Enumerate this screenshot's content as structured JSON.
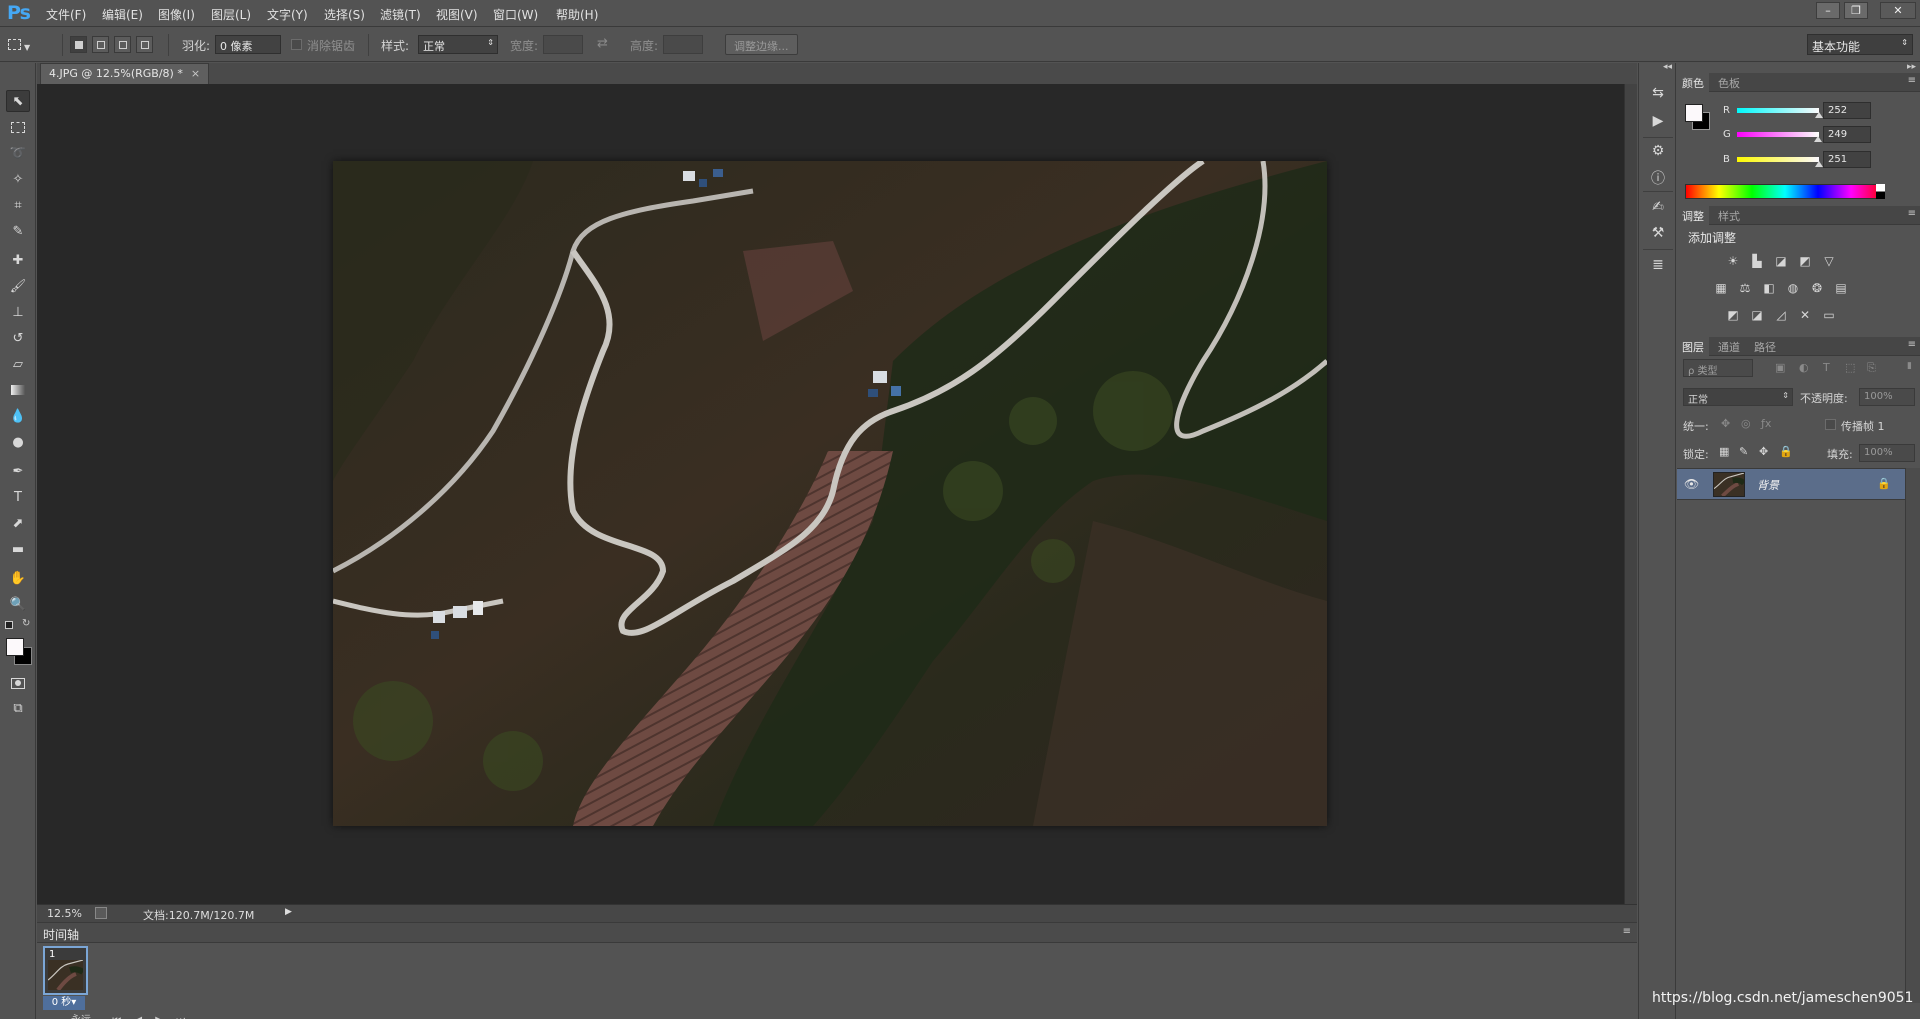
{
  "app": {
    "logo": "Ps"
  },
  "menu": [
    "文件(F)",
    "编辑(E)",
    "图像(I)",
    "图层(L)",
    "文字(Y)",
    "选择(S)",
    "滤镜(T)",
    "视图(V)",
    "窗口(W)",
    "帮助(H)"
  ],
  "window_controls": {
    "minimize": "–",
    "restore": "❐",
    "close": "✕"
  },
  "options": {
    "feather_label": "羽化:",
    "feather_value": "0 像素",
    "antialias_label": "消除锯齿",
    "style_label": "样式:",
    "style_value": "正常",
    "width_label": "宽度:",
    "height_label": "高度:",
    "refine_edge": "调整边缘...",
    "workspace": "基本功能"
  },
  "document": {
    "tab_title": "4.JPG @ 12.5%(RGB/8) *",
    "tab_close": "×"
  },
  "status": {
    "zoom": "12.5%",
    "doc_info": "文档:120.7M/120.7M"
  },
  "timeline": {
    "tab": "时间轴",
    "frame_number": "1",
    "frame_delay": "0 秒▾",
    "loop_label": "永远"
  },
  "color_panel": {
    "tabs": [
      "颜色",
      "色板"
    ],
    "r_label": "R",
    "r_value": "252",
    "g_label": "G",
    "g_value": "249",
    "b_label": "B",
    "b_value": "251",
    "foreground": "#fcf9fb",
    "background": "#000000"
  },
  "adjust_panel": {
    "tabs": [
      "调整",
      "样式"
    ],
    "heading": "添加调整"
  },
  "layers_panel": {
    "tabs": [
      "图层",
      "通道",
      "路径"
    ],
    "filter_kind": "ρ 类型",
    "blend_mode": "正常",
    "opacity_label": "不透明度:",
    "opacity_value": "100%",
    "unify_label": "统一:",
    "propagate_label": "传播帧 1",
    "lock_label": "锁定:",
    "fill_label": "填充:",
    "fill_value": "100%",
    "layer_name": "背景"
  },
  "watermark": "https://blog.csdn.net/jameschen9051"
}
